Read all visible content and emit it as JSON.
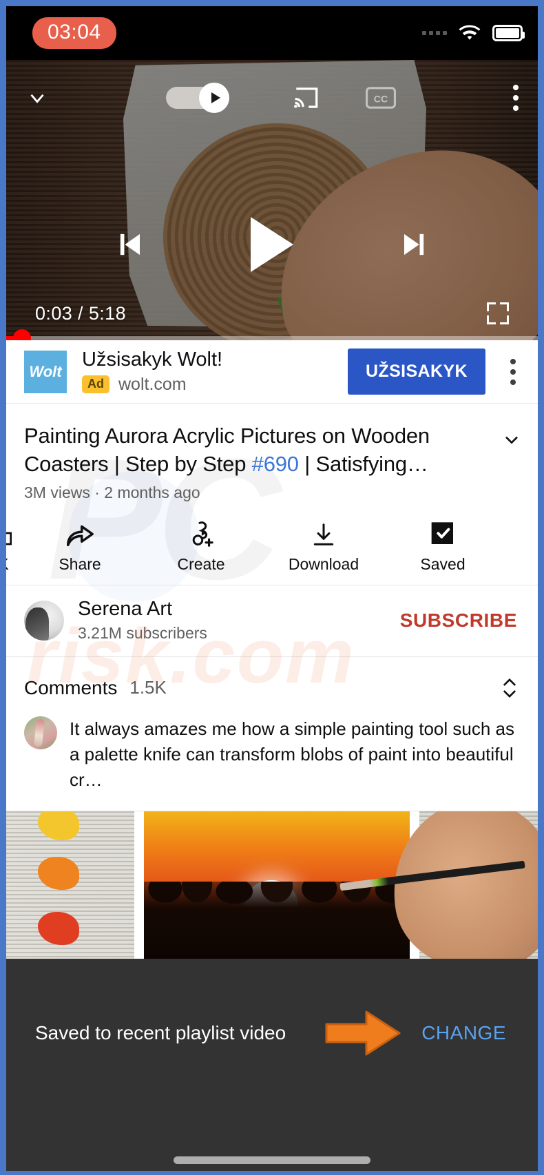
{
  "status_bar": {
    "clock": "03:04",
    "clock_badge_color": "#e8604c",
    "wifi_icon": "wifi-icon",
    "battery_icon": "battery-icon",
    "signal_icon": "signal-dots-icon"
  },
  "player": {
    "collapse_icon": "chevron-down-icon",
    "autoplay_toggle": "autoplay-toggle",
    "cast_icon": "cast-icon",
    "captions_icon": "closed-captions-icon",
    "more_icon": "more-vertical-icon",
    "previous_icon": "previous-track-icon",
    "play_icon": "play-icon",
    "next_icon": "next-track-icon",
    "current_time": "0:03",
    "separator": "/",
    "duration": "5:18",
    "timecode": "0:03 / 5:18",
    "fullscreen_icon": "fullscreen-icon",
    "progress_color": "#ff0000",
    "progress_percent": 1
  },
  "ad": {
    "logo_text": "Wolt",
    "logo_color": "#5cb0e0",
    "title": "Užsisakyk Wolt!",
    "badge": "Ad",
    "badge_color": "#fbc02d",
    "url": "wolt.com",
    "cta_label": "UŽSISAKYK",
    "cta_color": "#2a56c6",
    "more_icon": "more-vertical-icon"
  },
  "video": {
    "title_part1": "Painting Aurora Acrylic Pictures on Wooden Coasters | Step by Step ",
    "title_hashtag": "#690",
    "title_part2": " | Satisfying…",
    "expand_icon": "chevron-down-icon",
    "views": "3M views",
    "dot": "·",
    "published": "2 months ago",
    "meta": "3M views · 2 months ago"
  },
  "actions": [
    {
      "label": "K",
      "icon": "like-icon",
      "name": "like-button"
    },
    {
      "label": "Share",
      "icon": "share-icon",
      "name": "share-button"
    },
    {
      "label": "Create",
      "icon": "create-clip-icon",
      "name": "create-button"
    },
    {
      "label": "Download",
      "icon": "download-icon",
      "name": "download-button"
    },
    {
      "label": "Saved",
      "icon": "saved-checkbox-icon",
      "name": "saved-button"
    }
  ],
  "channel": {
    "avatar": "channel-avatar",
    "name": "Serena Art",
    "subscribers": "3.21M subscribers",
    "subscribe_label": "SUBSCRIBE",
    "subscribe_color": "#c0392b"
  },
  "comments": {
    "title": "Comments",
    "count": "1.5K",
    "expand_icon": "expand-collapse-icon",
    "first_comment": "It always amazes me how a simple painting tool such as a palette knife can transform blobs of paint into beautiful cr…"
  },
  "suggested_thumbnail": {
    "name": "suggested-video-thumbnail",
    "description": "sunset painting on canvas with brush"
  },
  "snackbar": {
    "message": "Saved to recent playlist video",
    "action_label": "CHANGE",
    "action_color": "#5aa3f0",
    "background": "#333333",
    "annotation_arrow_color": "#ef7d1e",
    "annotation_icon": "orange-arrow-annotation"
  },
  "gesture_bar": {
    "name": "home-gesture-bar"
  },
  "watermark": {
    "line1": "PC",
    "line2": "risk.com"
  }
}
